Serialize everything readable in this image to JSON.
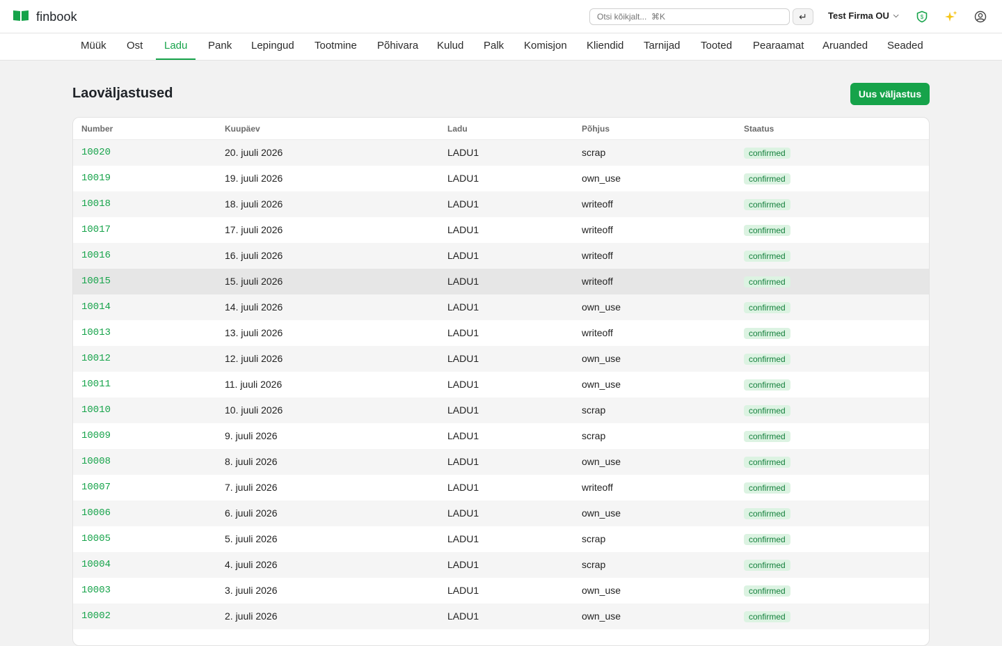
{
  "app": {
    "name": "finbook"
  },
  "search": {
    "placeholder": "Otsi kõikjalt...  ⌘K",
    "enter_symbol": "↵"
  },
  "company": {
    "name": "Test Firma OU",
    "chevron": "⌵"
  },
  "icons": {
    "logo": "book-icon",
    "shield": "shield-icon",
    "sparkle": "sparkles-icon",
    "user": "user-circle-icon"
  },
  "colors": {
    "accent": "#16a34a",
    "badge_bg": "#dcf3e2",
    "badge_text": "#15803d"
  },
  "nav": {
    "tabs": [
      {
        "label": "Müük"
      },
      {
        "label": "Ost"
      },
      {
        "label": "Ladu"
      },
      {
        "label": "Pank"
      },
      {
        "label": "Lepingud"
      },
      {
        "label": "Tootmine"
      },
      {
        "label": "Põhivara"
      },
      {
        "label": "Kulud"
      },
      {
        "label": "Palk"
      },
      {
        "label": "Komisjon"
      },
      {
        "label": "Kliendid"
      },
      {
        "label": "Tarnijad"
      },
      {
        "label": "Tooted"
      },
      {
        "label": "Pearaamat"
      },
      {
        "label": "Aruanded"
      },
      {
        "label": "Seaded"
      }
    ],
    "active": "Ladu"
  },
  "page": {
    "title": "Laoväljastused",
    "new_button": "Uus väljastus"
  },
  "table": {
    "headers": {
      "number": "Number",
      "date": "Kuupäev",
      "warehouse": "Ladu",
      "reason": "Põhjus",
      "status": "Staatus"
    },
    "rows": [
      {
        "number": "10020",
        "date": "20. juuli 2026",
        "warehouse": "LADU1",
        "reason": "scrap",
        "status": "confirmed"
      },
      {
        "number": "10019",
        "date": "19. juuli 2026",
        "warehouse": "LADU1",
        "reason": "own_use",
        "status": "confirmed"
      },
      {
        "number": "10018",
        "date": "18. juuli 2026",
        "warehouse": "LADU1",
        "reason": "writeoff",
        "status": "confirmed"
      },
      {
        "number": "10017",
        "date": "17. juuli 2026",
        "warehouse": "LADU1",
        "reason": "writeoff",
        "status": "confirmed"
      },
      {
        "number": "10016",
        "date": "16. juuli 2026",
        "warehouse": "LADU1",
        "reason": "writeoff",
        "status": "confirmed"
      },
      {
        "number": "10015",
        "date": "15. juuli 2026",
        "warehouse": "LADU1",
        "reason": "writeoff",
        "status": "confirmed"
      },
      {
        "number": "10014",
        "date": "14. juuli 2026",
        "warehouse": "LADU1",
        "reason": "own_use",
        "status": "confirmed"
      },
      {
        "number": "10013",
        "date": "13. juuli 2026",
        "warehouse": "LADU1",
        "reason": "writeoff",
        "status": "confirmed"
      },
      {
        "number": "10012",
        "date": "12. juuli 2026",
        "warehouse": "LADU1",
        "reason": "own_use",
        "status": "confirmed"
      },
      {
        "number": "10011",
        "date": "11. juuli 2026",
        "warehouse": "LADU1",
        "reason": "own_use",
        "status": "confirmed"
      },
      {
        "number": "10010",
        "date": "10. juuli 2026",
        "warehouse": "LADU1",
        "reason": "scrap",
        "status": "confirmed"
      },
      {
        "number": "10009",
        "date": "9. juuli 2026",
        "warehouse": "LADU1",
        "reason": "scrap",
        "status": "confirmed"
      },
      {
        "number": "10008",
        "date": "8. juuli 2026",
        "warehouse": "LADU1",
        "reason": "own_use",
        "status": "confirmed"
      },
      {
        "number": "10007",
        "date": "7. juuli 2026",
        "warehouse": "LADU1",
        "reason": "writeoff",
        "status": "confirmed"
      },
      {
        "number": "10006",
        "date": "6. juuli 2026",
        "warehouse": "LADU1",
        "reason": "own_use",
        "status": "confirmed"
      },
      {
        "number": "10005",
        "date": "5. juuli 2026",
        "warehouse": "LADU1",
        "reason": "scrap",
        "status": "confirmed"
      },
      {
        "number": "10004",
        "date": "4. juuli 2026",
        "warehouse": "LADU1",
        "reason": "scrap",
        "status": "confirmed"
      },
      {
        "number": "10003",
        "date": "3. juuli 2026",
        "warehouse": "LADU1",
        "reason": "own_use",
        "status": "confirmed"
      },
      {
        "number": "10002",
        "date": "2. juuli 2026",
        "warehouse": "LADU1",
        "reason": "own_use",
        "status": "confirmed"
      }
    ]
  }
}
